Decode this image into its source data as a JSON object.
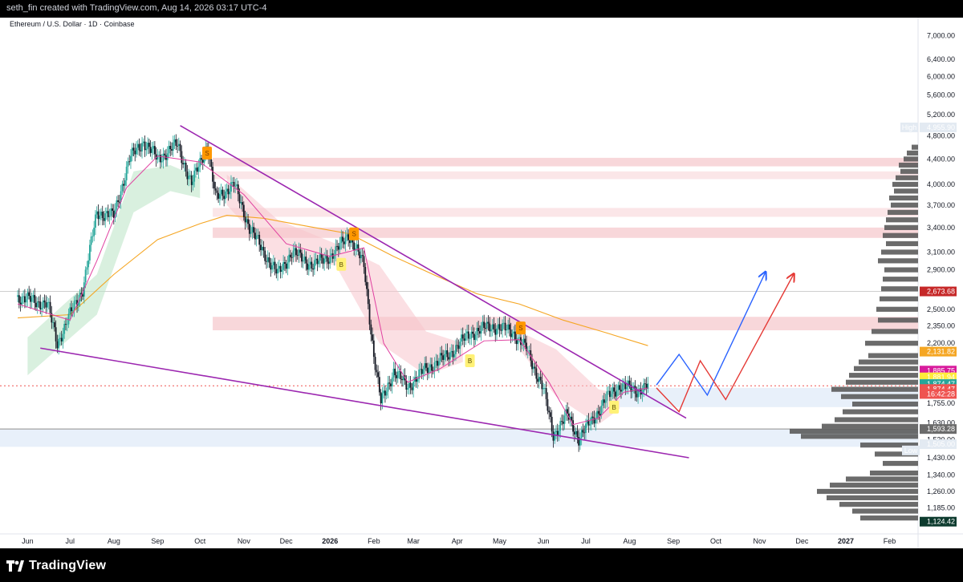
{
  "header": {
    "credit": "seth_fin created with TradingView.com, Aug 14, 2026 03:17 UTC-4"
  },
  "footer": {
    "brand": "TradingView"
  },
  "chart_data": {
    "type": "line",
    "symbol_title": "Ethereum / U.S. Dollar · 1D · Coinbase",
    "y_scale": "log",
    "ylim": [
      1100,
      7400
    ],
    "y_ticks": [
      "7,000.00",
      "6,400.00",
      "6,000.00",
      "5,600.00",
      "5,200.00",
      "4,800.00",
      "4,400.00",
      "4,000.00",
      "3,700.00",
      "3,400.00",
      "3,100.00",
      "2,900.00",
      "2,500.00",
      "2,350.00",
      "2,200.00",
      "1,755.00",
      "1,630.00",
      "1,530.00",
      "1,430.00",
      "1,340.00",
      "1,260.00",
      "1,185.00"
    ],
    "x_ticks": [
      {
        "label": "Jun",
        "date": "2025-06-01"
      },
      {
        "label": "Jul",
        "date": "2025-07-01"
      },
      {
        "label": "Aug",
        "date": "2025-08-01"
      },
      {
        "label": "Sep",
        "date": "2025-09-01"
      },
      {
        "label": "Oct",
        "date": "2025-10-01"
      },
      {
        "label": "Nov",
        "date": "2025-11-01"
      },
      {
        "label": "Dec",
        "date": "2025-12-01"
      },
      {
        "label": "2026",
        "date": "2026-01-01",
        "bold": true
      },
      {
        "label": "Feb",
        "date": "2026-02-01"
      },
      {
        "label": "Mar",
        "date": "2026-03-01"
      },
      {
        "label": "Apr",
        "date": "2026-04-01"
      },
      {
        "label": "May",
        "date": "2026-05-01"
      },
      {
        "label": "Jun",
        "date": "2026-06-01"
      },
      {
        "label": "Jul",
        "date": "2026-07-01"
      },
      {
        "label": "Aug",
        "date": "2026-08-01"
      },
      {
        "label": "Sep",
        "date": "2026-09-01"
      },
      {
        "label": "Oct",
        "date": "2026-10-01"
      },
      {
        "label": "Nov",
        "date": "2026-11-01"
      },
      {
        "label": "Dec",
        "date": "2026-12-01"
      },
      {
        "label": "2027",
        "date": "2027-01-01",
        "bold": true
      },
      {
        "label": "Feb",
        "date": "2027-02-01"
      }
    ],
    "price_series": {
      "name": "ETH/USD",
      "points": [
        [
          "2025-05-25",
          2620
        ],
        [
          "2025-06-05",
          2580
        ],
        [
          "2025-06-15",
          2550
        ],
        [
          "2025-06-22",
          2200
        ],
        [
          "2025-07-01",
          2450
        ],
        [
          "2025-07-10",
          2700
        ],
        [
          "2025-07-20",
          3600
        ],
        [
          "2025-08-01",
          3550
        ],
        [
          "2025-08-12",
          4400
        ],
        [
          "2025-08-22",
          4700
        ],
        [
          "2025-09-01",
          4400
        ],
        [
          "2025-09-15",
          4650
        ],
        [
          "2025-09-25",
          4000
        ],
        [
          "2025-10-06",
          4650
        ],
        [
          "2025-10-12",
          3800
        ],
        [
          "2025-10-25",
          4000
        ],
        [
          "2025-11-05",
          3400
        ],
        [
          "2025-11-15",
          3100
        ],
        [
          "2025-11-25",
          2850
        ],
        [
          "2025-12-05",
          3100
        ],
        [
          "2025-12-20",
          2950
        ],
        [
          "2026-01-05",
          3100
        ],
        [
          "2026-01-14",
          3320
        ],
        [
          "2026-01-25",
          2950
        ],
        [
          "2026-02-01",
          2100
        ],
        [
          "2026-02-06",
          1760
        ],
        [
          "2026-02-15",
          1980
        ],
        [
          "2026-02-25",
          1870
        ],
        [
          "2026-03-10",
          2000
        ],
        [
          "2026-03-25",
          2100
        ],
        [
          "2026-04-10",
          2280
        ],
        [
          "2026-04-25",
          2350
        ],
        [
          "2026-05-10",
          2300
        ],
        [
          "2026-05-20",
          2150
        ],
        [
          "2026-06-01",
          1850
        ],
        [
          "2026-06-08",
          1560
        ],
        [
          "2026-06-18",
          1680
        ],
        [
          "2026-06-26",
          1540
        ],
        [
          "2026-07-05",
          1640
        ],
        [
          "2026-07-15",
          1780
        ],
        [
          "2026-07-25",
          1880
        ],
        [
          "2026-08-05",
          1840
        ],
        [
          "2026-08-14",
          1874
        ]
      ]
    },
    "moving_average_long": {
      "color": "#f5a623",
      "points": [
        [
          "2025-05-25",
          2420
        ],
        [
          "2025-07-01",
          2450
        ],
        [
          "2025-08-01",
          2850
        ],
        [
          "2025-09-01",
          3250
        ],
        [
          "2025-10-01",
          3450
        ],
        [
          "2025-10-20",
          3560
        ],
        [
          "2025-11-15",
          3520
        ],
        [
          "2025-12-15",
          3420
        ],
        [
          "2026-01-15",
          3320
        ],
        [
          "2026-02-15",
          3050
        ],
        [
          "2026-03-15",
          2850
        ],
        [
          "2026-04-15",
          2650
        ],
        [
          "2026-05-15",
          2550
        ],
        [
          "2026-06-15",
          2400
        ],
        [
          "2026-07-15",
          2290
        ],
        [
          "2026-08-14",
          2180
        ]
      ]
    },
    "moving_average_short": {
      "color": "#e040a0",
      "points": [
        [
          "2025-05-25",
          2550
        ],
        [
          "2025-07-01",
          2400
        ],
        [
          "2025-07-20",
          3000
        ],
        [
          "2025-08-10",
          3950
        ],
        [
          "2025-09-01",
          4450
        ],
        [
          "2025-10-01",
          4350
        ],
        [
          "2025-11-01",
          3850
        ],
        [
          "2025-12-01",
          3200
        ],
        [
          "2026-01-01",
          3050
        ],
        [
          "2026-01-25",
          3150
        ],
        [
          "2026-02-08",
          2200
        ],
        [
          "2026-02-25",
          1900
        ],
        [
          "2026-03-20",
          2000
        ],
        [
          "2026-04-20",
          2220
        ],
        [
          "2026-05-15",
          2230
        ],
        [
          "2026-06-05",
          1900
        ],
        [
          "2026-06-22",
          1620
        ],
        [
          "2026-07-10",
          1660
        ],
        [
          "2026-07-28",
          1830
        ],
        [
          "2026-08-14",
          1860
        ]
      ]
    },
    "trendline_upper": {
      "from": [
        "2025-09-17",
        4990
      ],
      "to": [
        "2026-09-10",
        1660
      ],
      "color": "#9c27b0"
    },
    "trendline_lower": {
      "from": [
        "2025-06-10",
        2160
      ],
      "to": [
        "2026-09-12",
        1430
      ],
      "color": "#9c27b0"
    },
    "resistance_zones": [
      {
        "from": 4280,
        "to": 4420,
        "color": "#f8d7da"
      },
      {
        "from": 4080,
        "to": 4200,
        "color": "#fbe6e8"
      },
      {
        "from": 3540,
        "to": 3660,
        "color": "#fbe6e8"
      },
      {
        "from": 3270,
        "to": 3400,
        "color": "#f8d7da"
      },
      {
        "from": 2310,
        "to": 2430,
        "color": "#f8d7da"
      }
    ],
    "support_zones": [
      {
        "from": 1730,
        "to": 1860,
        "color": "#e8f0fa"
      },
      {
        "from": 1490,
        "to": 1590,
        "color": "#e8f0fa"
      }
    ],
    "horizontal_lines": [
      {
        "y": 2673.68,
        "color": "#cfcfcf"
      },
      {
        "y": 1593.28,
        "color": "#8a8a8a"
      },
      {
        "y": 1874.47,
        "color": "#ef5350",
        "dashed": true
      }
    ],
    "projection_blue": {
      "color": "#2962ff",
      "points": [
        [
          "2026-08-20",
          1880
        ],
        [
          "2026-09-05",
          2110
        ],
        [
          "2026-09-25",
          1810
        ],
        [
          "2026-11-05",
          2870
        ]
      ]
    },
    "projection_red": {
      "color": "#e53935",
      "points": [
        [
          "2026-08-20",
          1860
        ],
        [
          "2026-09-05",
          1700
        ],
        [
          "2026-09-20",
          2060
        ],
        [
          "2026-10-08",
          1780
        ],
        [
          "2026-11-25",
          2850
        ]
      ]
    },
    "signals": [
      {
        "label": "S",
        "date": "2025-10-06",
        "price": 4500,
        "type": "sell"
      },
      {
        "label": "S",
        "date": "2026-01-18",
        "price": 3320,
        "type": "sell"
      },
      {
        "label": "S",
        "date": "2026-05-16",
        "price": 2330,
        "type": "sell"
      },
      {
        "label": "B",
        "date": "2026-01-09",
        "price": 2960,
        "type": "buy"
      },
      {
        "label": "B",
        "date": "2026-04-10",
        "price": 2060,
        "type": "buy"
      },
      {
        "label": "B",
        "date": "2026-07-21",
        "price": 1730,
        "type": "buy"
      }
    ],
    "price_labels": [
      {
        "text": "High",
        "value": "4,955.90",
        "price": 4955.9,
        "bg": "#e3eaf2",
        "fg": "#131722"
      },
      {
        "text": "",
        "value": "2,673.68",
        "price": 2673.68,
        "bg": "#c62828",
        "fg": "#ffffff"
      },
      {
        "text": "",
        "value": "2,131.82",
        "price": 2131.82,
        "bg": "#f5a623",
        "fg": "#ffffff"
      },
      {
        "text": "",
        "value": "1,885.75",
        "price": 1985,
        "bg": "#d81b9c",
        "fg": "#ffffff"
      },
      {
        "text": "",
        "value": "1,881.94",
        "price": 1935,
        "bg": "#ffeb3b",
        "fg": "#131722"
      },
      {
        "text": "",
        "value": "1,874.47",
        "price": 1887,
        "bg": "#26a69a",
        "fg": "#ffffff"
      },
      {
        "text": "",
        "value": "1,874.47",
        "price": 1852,
        "bg": "#ef5350",
        "fg": "#ffffff"
      },
      {
        "text": "",
        "value": "16:42:28",
        "price": 1818,
        "bg": "#ef5350",
        "fg": "#ffffff"
      },
      {
        "text": "",
        "value": "1,593.28",
        "price": 1593.28,
        "bg": "#6b6b6b",
        "fg": "#ffffff"
      },
      {
        "text": "",
        "value": "1,505.00",
        "price": 1505,
        "bg": "#e3eaf2",
        "fg": "#131722"
      },
      {
        "text": "Low",
        "value": "",
        "price": 1470,
        "bg": "#e3eaf2",
        "fg": "#131722"
      },
      {
        "text": "",
        "value": "1,124.42",
        "price": 1124.42,
        "bg": "#0d3b2e",
        "fg": "#ffffff"
      }
    ],
    "volume_profile": [
      [
        4600,
        8
      ],
      [
        4500,
        14
      ],
      [
        4400,
        18
      ],
      [
        4300,
        24
      ],
      [
        4200,
        22
      ],
      [
        4100,
        28
      ],
      [
        4000,
        32
      ],
      [
        3900,
        30
      ],
      [
        3800,
        36
      ],
      [
        3700,
        34
      ],
      [
        3600,
        38
      ],
      [
        3500,
        40
      ],
      [
        3400,
        42
      ],
      [
        3300,
        44
      ],
      [
        3200,
        40
      ],
      [
        3100,
        46
      ],
      [
        3000,
        50
      ],
      [
        2900,
        42
      ],
      [
        2800,
        44
      ],
      [
        2700,
        46
      ],
      [
        2600,
        48
      ],
      [
        2500,
        52
      ],
      [
        2400,
        50
      ],
      [
        2300,
        58
      ],
      [
        2200,
        66
      ],
      [
        2100,
        62
      ],
      [
        2050,
        74
      ],
      [
        2000,
        80
      ],
      [
        1950,
        86
      ],
      [
        1900,
        90
      ],
      [
        1850,
        108
      ],
      [
        1800,
        96
      ],
      [
        1750,
        82
      ],
      [
        1700,
        94
      ],
      [
        1650,
        104
      ],
      [
        1610,
        120
      ],
      [
        1580,
        160
      ],
      [
        1550,
        146
      ],
      [
        1500,
        72
      ],
      [
        1450,
        54
      ],
      [
        1400,
        44
      ],
      [
        1350,
        60
      ],
      [
        1320,
        90
      ],
      [
        1290,
        110
      ],
      [
        1260,
        126
      ],
      [
        1230,
        114
      ],
      [
        1200,
        98
      ],
      [
        1170,
        82
      ],
      [
        1140,
        72
      ]
    ]
  }
}
